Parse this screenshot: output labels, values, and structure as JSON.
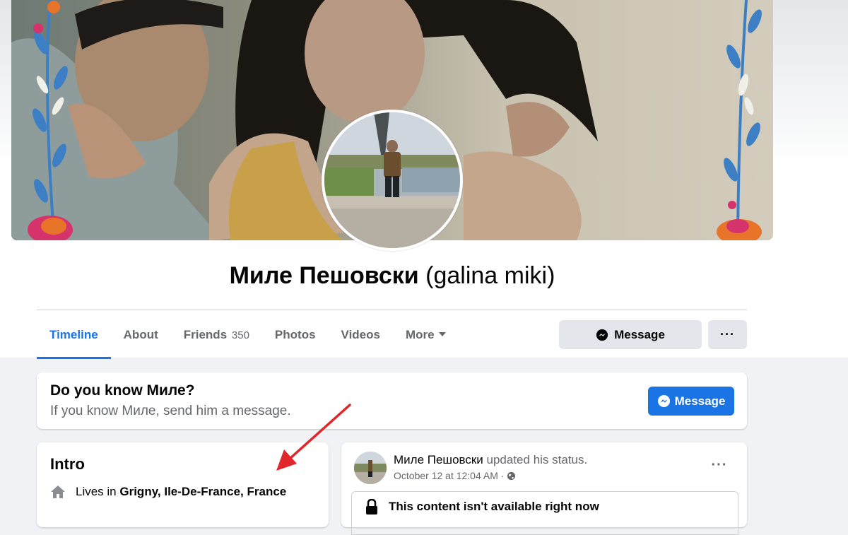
{
  "profile": {
    "name": "Миле Пешовски",
    "alternate_name": "(galina miki)"
  },
  "tabs": [
    {
      "label": "Timeline",
      "active": true
    },
    {
      "label": "About"
    },
    {
      "label": "Friends",
      "count": "350"
    },
    {
      "label": "Photos"
    },
    {
      "label": "Videos"
    },
    {
      "label": "More"
    }
  ],
  "actions": {
    "message_label": "Message",
    "more_label": "···"
  },
  "know_card": {
    "title": "Do you know Миле?",
    "subtitle": "If you know Миле, send him a message.",
    "button_label": "Message"
  },
  "intro": {
    "title": "Intro",
    "lives_prefix": "Lives in ",
    "lives_location": "Grigny, Ile-De-France, France"
  },
  "post": {
    "author": "Миле Пешовски",
    "action": " updated his status.",
    "timestamp": "October 12 at 12:04 AM · ",
    "more_label": "···",
    "unavailable_text": "This content isn't available right now"
  },
  "colors": {
    "accent": "#1b74e4",
    "annotation_arrow": "#e0262a"
  },
  "icons": {
    "messenger": "messenger-icon",
    "globe": "globe-icon",
    "home": "home-icon",
    "lock": "lock-icon"
  }
}
